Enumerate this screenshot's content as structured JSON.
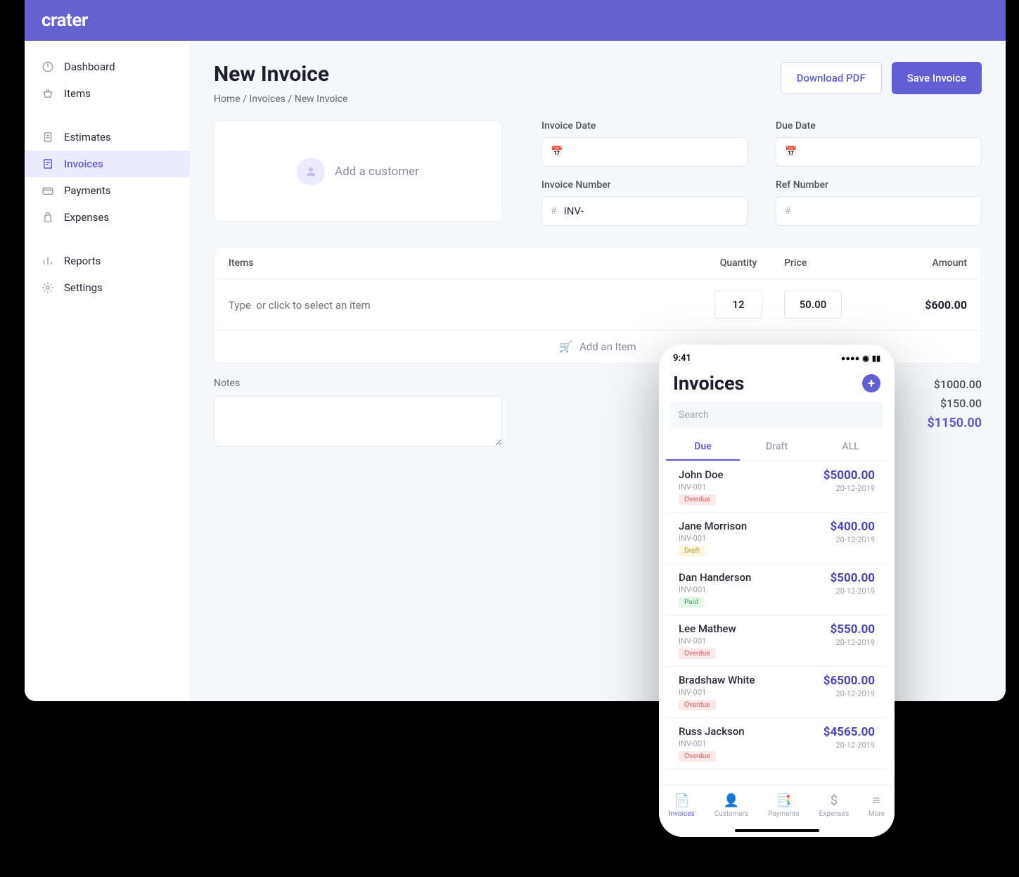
{
  "brand": "crater",
  "sidebar": {
    "group1": [
      {
        "label": "Dashboard",
        "icon": "dashboard"
      },
      {
        "label": "Items",
        "icon": "basket"
      }
    ],
    "group2": [
      {
        "label": "Estimates",
        "icon": "doc"
      },
      {
        "label": "Invoices",
        "icon": "invoice",
        "active": true
      },
      {
        "label": "Payments",
        "icon": "card"
      },
      {
        "label": "Expenses",
        "icon": "bag"
      }
    ],
    "group3": [
      {
        "label": "Reports",
        "icon": "bars"
      },
      {
        "label": "Settings",
        "icon": "gear"
      }
    ]
  },
  "page": {
    "title": "New Invoice",
    "crumbs": [
      "Home",
      "Invoices",
      "New Invoice"
    ],
    "download_label": "Download PDF",
    "save_label": "Save Invoice"
  },
  "form": {
    "customer_placeholder": "Add a customer",
    "invoice_date_label": "Invoice Date",
    "due_date_label": "Due Date",
    "invoice_number_label": "Invoice Number",
    "invoice_number_value": "INV-",
    "ref_number_label": "Ref Number"
  },
  "items": {
    "head": {
      "item": "Items",
      "qty": "Quantity",
      "price": "Price",
      "amount": "Amount"
    },
    "row": {
      "placeholder": "Type  or click to select an item",
      "qty": "12",
      "price": "50.00",
      "amount": "$600.00"
    },
    "add_label": "Add an Item"
  },
  "notes": {
    "label": "Notes"
  },
  "totals": {
    "sub": "$1000.00",
    "tax": "$150.00",
    "grand": "$1150.00"
  },
  "mobile": {
    "time": "9:41",
    "title": "Invoices",
    "search_placeholder": "Search",
    "tabs": [
      "Due",
      "Draft",
      "ALL"
    ],
    "rows": [
      {
        "name": "John Doe",
        "num": "INV-001",
        "status": "Overdue",
        "statusClass": "overdue",
        "amount": "$5000.00",
        "date": "20-12-2019"
      },
      {
        "name": "Jane Morrison",
        "num": "INV-001",
        "status": "Draft",
        "statusClass": "draft",
        "amount": "$400.00",
        "date": "20-12-2019"
      },
      {
        "name": "Dan Handerson",
        "num": "INV-001",
        "status": "Paid",
        "statusClass": "paid",
        "amount": "$500.00",
        "date": "20-12-2019"
      },
      {
        "name": "Lee Mathew",
        "num": "INV-001",
        "status": "Overdue",
        "statusClass": "overdue",
        "amount": "$550.00",
        "date": "20-12-2019"
      },
      {
        "name": "Bradshaw White",
        "num": "INV-001",
        "status": "Overdue",
        "statusClass": "overdue",
        "amount": "$6500.00",
        "date": "20-12-2019"
      },
      {
        "name": "Russ Jackson",
        "num": "INV-001",
        "status": "Overdue",
        "statusClass": "overdue",
        "amount": "$4565.00",
        "date": "20-12-2019"
      }
    ],
    "nav": [
      {
        "label": "Invoices",
        "active": true
      },
      {
        "label": "Customers"
      },
      {
        "label": "Payments"
      },
      {
        "label": "Expenses"
      },
      {
        "label": "More"
      }
    ]
  }
}
